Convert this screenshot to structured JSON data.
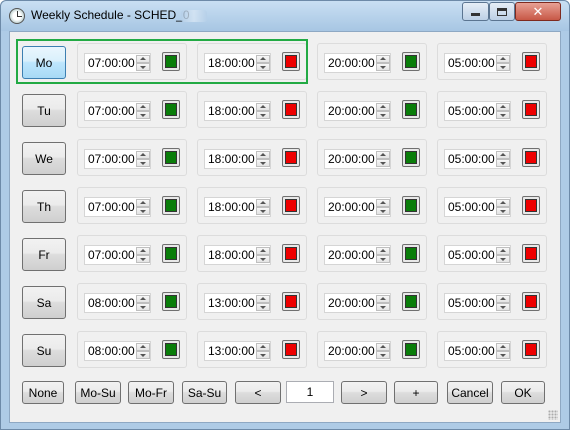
{
  "window": {
    "title": "Weekly Schedule - SCHED_0"
  },
  "rows": [
    {
      "day": "Mo",
      "active": true,
      "times": [
        "07:00:00",
        "18:00:00",
        "20:00:00",
        "05:00:00"
      ],
      "colors": [
        "#0a7d0a",
        "#ee0000",
        "#0a7d0a",
        "#ee0000"
      ]
    },
    {
      "day": "Tu",
      "active": false,
      "times": [
        "07:00:00",
        "18:00:00",
        "20:00:00",
        "05:00:00"
      ],
      "colors": [
        "#0a7d0a",
        "#ee0000",
        "#0a7d0a",
        "#ee0000"
      ]
    },
    {
      "day": "We",
      "active": false,
      "times": [
        "07:00:00",
        "18:00:00",
        "20:00:00",
        "05:00:00"
      ],
      "colors": [
        "#0a7d0a",
        "#ee0000",
        "#0a7d0a",
        "#ee0000"
      ]
    },
    {
      "day": "Th",
      "active": false,
      "times": [
        "07:00:00",
        "18:00:00",
        "20:00:00",
        "05:00:00"
      ],
      "colors": [
        "#0a7d0a",
        "#ee0000",
        "#0a7d0a",
        "#ee0000"
      ]
    },
    {
      "day": "Fr",
      "active": false,
      "times": [
        "07:00:00",
        "18:00:00",
        "20:00:00",
        "05:00:00"
      ],
      "colors": [
        "#0a7d0a",
        "#ee0000",
        "#0a7d0a",
        "#ee0000"
      ]
    },
    {
      "day": "Sa",
      "active": false,
      "times": [
        "08:00:00",
        "13:00:00",
        "20:00:00",
        "05:00:00"
      ],
      "colors": [
        "#0a7d0a",
        "#ee0000",
        "#0a7d0a",
        "#ee0000"
      ]
    },
    {
      "day": "Su",
      "active": false,
      "times": [
        "08:00:00",
        "13:00:00",
        "20:00:00",
        "05:00:00"
      ],
      "colors": [
        "#0a7d0a",
        "#ee0000",
        "#0a7d0a",
        "#ee0000"
      ]
    }
  ],
  "bottom": {
    "none": "None",
    "mo_su": "Mo-Su",
    "mo_fr": "Mo-Fr",
    "sa_su": "Sa-Su",
    "prev": "<",
    "page": "1",
    "next": ">",
    "add": "+",
    "cancel": "Cancel",
    "ok": "OK"
  },
  "colors": {
    "on": "#0a7d0a",
    "off": "#ee0000",
    "highlight": "#22aa44",
    "titlebar": "#aecbe6"
  }
}
